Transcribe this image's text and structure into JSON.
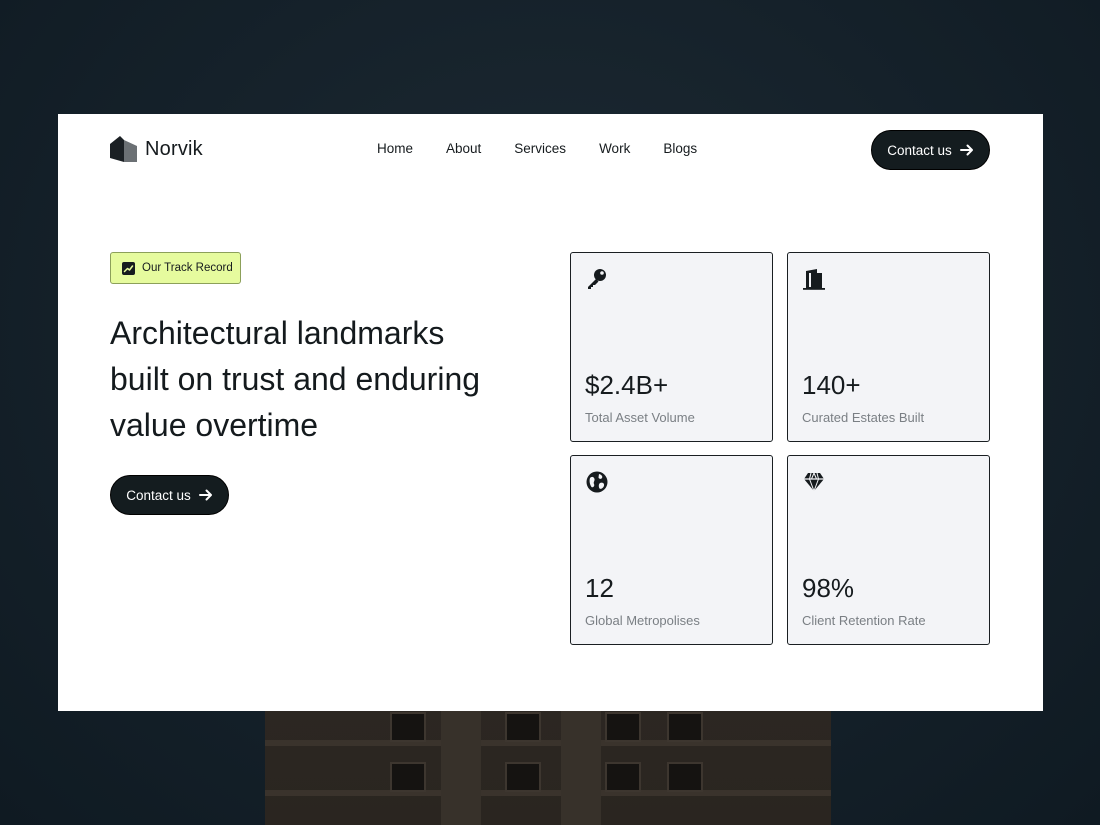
{
  "brand": {
    "name": "Norvik"
  },
  "nav": {
    "items": [
      {
        "label": "Home"
      },
      {
        "label": "About"
      },
      {
        "label": "Services"
      },
      {
        "label": "Work"
      },
      {
        "label": "Blogs"
      }
    ],
    "cta_label": "Contact us"
  },
  "hero": {
    "badge_label": "Our Track Record",
    "badge_icon": "trending-chart-icon",
    "headline": "Architectural landmarks built on trust and enduring value overtime",
    "cta_label": "Contact us"
  },
  "stats": [
    {
      "icon": "key-icon",
      "value": "$2.4B+",
      "label": "Total Asset Volume"
    },
    {
      "icon": "building-icon",
      "value": "140+",
      "label": "Curated Estates Built"
    },
    {
      "icon": "globe-icon",
      "value": "12",
      "label": "Global Metropolises"
    },
    {
      "icon": "diamond-icon",
      "value": "98%",
      "label": "Client Retention Rate"
    }
  ],
  "colors": {
    "background": "#15212a",
    "card": "#ffffff",
    "button": "#141c1f",
    "badge": "#e6fb9e",
    "tile": "#f3f4f7",
    "muted_text": "#7a7f84"
  }
}
